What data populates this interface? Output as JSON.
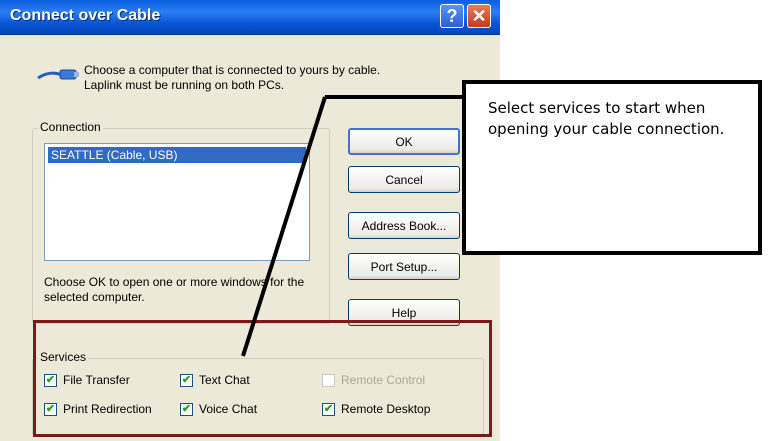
{
  "dialog": {
    "title": "Connect over Cable",
    "help_glyph": "?",
    "close_glyph": "✕",
    "intro": "Choose a computer that is connected to yours by cable.  Laplink must be running on both PCs.",
    "intro_icon": "cable-icon",
    "connection_group_label": "Connection",
    "connections": [
      "SEATTLE (Cable, USB)"
    ],
    "hint": "Choose OK to open one or more windows for the selected computer.",
    "buttons": {
      "ok": "OK",
      "cancel": "Cancel",
      "address_book": "Address Book...",
      "port_setup": "Port Setup...",
      "help": "Help"
    },
    "services_group_label": "Services",
    "services": {
      "file_transfer": {
        "label": "File Transfer",
        "checked": true,
        "enabled": true
      },
      "text_chat": {
        "label": "Text Chat",
        "checked": true,
        "enabled": true
      },
      "remote_control": {
        "label": "Remote Control",
        "checked": false,
        "enabled": false
      },
      "print_redirection": {
        "label": "Print Redirection",
        "checked": true,
        "enabled": true
      },
      "voice_chat": {
        "label": "Voice Chat",
        "checked": true,
        "enabled": true
      },
      "remote_desktop": {
        "label": "Remote Desktop",
        "checked": true,
        "enabled": true
      }
    }
  },
  "callout": {
    "text": "Select services to start when opening your cable connection."
  },
  "colors": {
    "highlight_border": "#7b1a1a",
    "title_bar": "#0a5fe0",
    "selection": "#316ac5"
  }
}
